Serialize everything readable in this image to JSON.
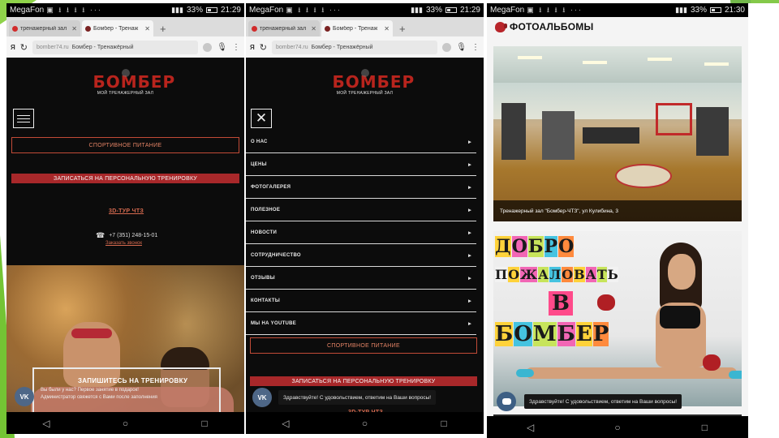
{
  "colors": {
    "accent_red": "#a8282a",
    "logo_red": "#b8241d",
    "outline_orange": "#c24b37",
    "vk_blue": "#4e6787",
    "slide_green": "#74c434"
  },
  "status_bar": {
    "carrier": "MegaFon",
    "battery": "33%",
    "times": [
      "21:29",
      "21:29",
      "21:30"
    ]
  },
  "browser": {
    "tabs": [
      {
        "label": "тренажерный зал",
        "icon": "yandex-icon"
      },
      {
        "label": "Бомбер - Тренаж",
        "icon": "site-favicon"
      }
    ],
    "new_tab": "+",
    "url_domain": "bomber74.ru",
    "url_title": "Бомбер - Тренажёрный"
  },
  "site": {
    "logo_word": "БОМБЕР",
    "logo_sub": "МОЙ ТРЕНАЖЕРНЫЙ ЗАЛ",
    "sport_nutrition": "СПОРТИВНОЕ ПИТАНИЕ",
    "signup_personal": "ЗАПИСАТЬСЯ НА ПЕРСОНАЛЬНУЮ ТРЕНИРОВКУ",
    "tour_3d": "3D-ТУР ЧТЗ",
    "phone": "+7 (351) 248-15-01",
    "order_call": "Заказать звонок",
    "hero_title": "ЗАПИШИТЕСЬ НА ТРЕНИРОВКУ",
    "hero_line1": "Вы были у нас? Первое занятие в подарок!",
    "hero_line2": "Администратор свяжется с Вами после заполнения",
    "vk_label": "VK",
    "chat_greeting": "Здравствуйте! С удовольствием, ответим на Ваши вопросы!"
  },
  "menu": {
    "items": [
      {
        "label": "О НАС",
        "arrow": "▸"
      },
      {
        "label": "ЦЕНЫ",
        "arrow": "▸"
      },
      {
        "label": "ФОТОГАЛЕРЕЯ",
        "arrow": "▸"
      },
      {
        "label": "ПОЛЕЗНОЕ",
        "arrow": "▸"
      },
      {
        "label": "НОВОСТИ",
        "arrow": "▸"
      },
      {
        "label": "СОТРУДНИЧЕСТВО",
        "arrow": "▸"
      },
      {
        "label": "ОТЗЫВЫ",
        "arrow": "▸"
      },
      {
        "label": "КОНТАКТЫ",
        "arrow": "▸"
      },
      {
        "label": "МЫ НА YOUTUBE",
        "arrow": "▸"
      }
    ]
  },
  "albums": {
    "title": "ФОТОАЛЬБОМЫ",
    "album1_caption": "Тренажерный зал \"Бомбер-ЧТЗ\", ул Кулибина, 3",
    "album2_letters_row1": [
      "Д",
      "О",
      "Б",
      "Р",
      "О"
    ],
    "album2_letters_row2": [
      "П",
      "О",
      "Ж",
      "А",
      "Л",
      "О",
      "В",
      "А",
      "Т",
      "Ь"
    ],
    "album2_letters_row3": [
      "В"
    ],
    "album2_letters_row4": [
      "Б",
      "О",
      "М",
      "Б",
      "Е",
      "Р"
    ],
    "chat_greeting": "Здравствуйте! С удовольствием, ответим на Ваши вопросы!"
  },
  "navbar": {
    "back": "◁",
    "home": "○",
    "recent": "□"
  }
}
